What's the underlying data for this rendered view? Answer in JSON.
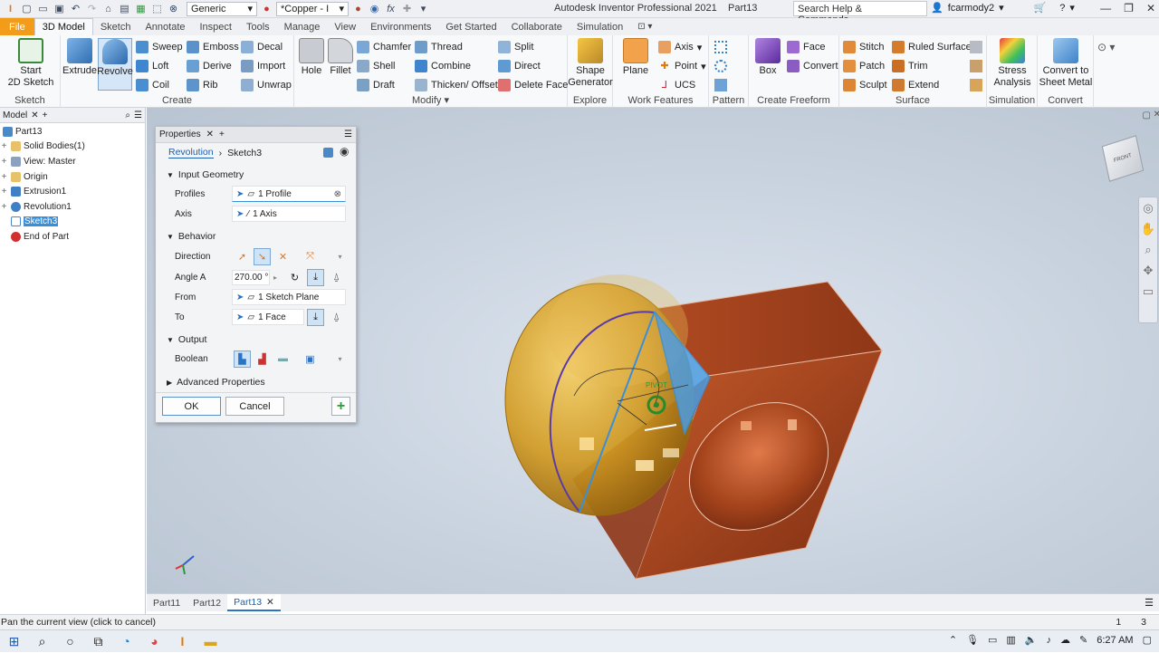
{
  "app": {
    "title": "Autodesk Inventor Professional 2021",
    "document": "Part13",
    "appearance_dropdown": "Generic",
    "material_dropdown": "*Copper - I",
    "search_placeholder": "Search Help & Commands...",
    "user": "fcarmody2",
    "fx_label": "fx"
  },
  "ribbon_tabs": [
    "File",
    "3D Model",
    "Sketch",
    "Annotate",
    "Inspect",
    "Tools",
    "Manage",
    "View",
    "Environments",
    "Get Started",
    "Collaborate",
    "Simulation"
  ],
  "ribbon": {
    "sketch": {
      "label": "Sketch",
      "start_sketch": "Start\n2D Sketch"
    },
    "create": {
      "label": "Create",
      "extrude": "Extrude",
      "revolve": "Revolve",
      "sweep": "Sweep",
      "emboss": "Emboss",
      "decal": "Decal",
      "loft": "Loft",
      "derive": "Derive",
      "import": "Import",
      "coil": "Coil",
      "rib": "Rib",
      "unwrap": "Unwrap"
    },
    "modify": {
      "label": "Modify",
      "hole": "Hole",
      "fillet": "Fillet",
      "chamfer": "Chamfer",
      "thread": "Thread",
      "split": "Split",
      "shell": "Shell",
      "combine": "Combine",
      "direct": "Direct",
      "draft": "Draft",
      "thicken": "Thicken/ Offset",
      "delete_face": "Delete Face"
    },
    "explore": {
      "label": "Explore",
      "shape_generator": "Shape\nGenerator"
    },
    "work_features": {
      "label": "Work Features",
      "plane": "Plane",
      "axis": "Axis",
      "point": "Point",
      "ucs": "UCS"
    },
    "pattern": {
      "label": "Pattern"
    },
    "freeform": {
      "label": "Create Freeform",
      "box": "Box",
      "face": "Face",
      "convert": "Convert"
    },
    "surface": {
      "label": "Surface",
      "stitch": "Stitch",
      "ruled_surface": "Ruled Surface",
      "patch": "Patch",
      "trim": "Trim",
      "sculpt": "Sculpt",
      "extend": "Extend"
    },
    "simulation": {
      "label": "Simulation",
      "stress": "Stress\nAnalysis"
    },
    "convert": {
      "label": "Convert",
      "sheet_metal": "Convert to\nSheet Metal"
    }
  },
  "browser": {
    "tab": "Model",
    "items": [
      {
        "label": "Part13",
        "expand": ""
      },
      {
        "label": "Solid Bodies(1)",
        "expand": "+"
      },
      {
        "label": "View: Master",
        "expand": "+"
      },
      {
        "label": "Origin",
        "expand": "+"
      },
      {
        "label": "Extrusion1",
        "expand": "+"
      },
      {
        "label": "Revolution1",
        "expand": "+"
      },
      {
        "label": "Sketch3",
        "expand": ""
      },
      {
        "label": "End of Part",
        "expand": ""
      }
    ]
  },
  "properties": {
    "tab": "Properties",
    "crumb_feature": "Revolution",
    "crumb_sketch": "Sketch3",
    "input_geometry": "Input Geometry",
    "profiles_label": "Profiles",
    "profiles_value": "1 Profile",
    "axis_label": "Axis",
    "axis_value": "1 Axis",
    "behavior": "Behavior",
    "direction_label": "Direction",
    "angle_label": "Angle A",
    "angle_value": "270.00 °",
    "from_label": "From",
    "from_value": "1 Sketch Plane",
    "to_label": "To",
    "to_value": "1 Face",
    "output": "Output",
    "boolean_label": "Boolean",
    "advanced": "Advanced Properties",
    "ok": "OK",
    "cancel": "Cancel"
  },
  "viewport": {
    "pivot_label": "PIVOT",
    "viewcube_label": "FRONT"
  },
  "doc_tabs": [
    "Part11",
    "Part12",
    "Part13"
  ],
  "status": {
    "text": "Pan the current view (click to cancel)",
    "num1": "1",
    "num2": "3"
  },
  "taskbar": {
    "time": "6:27 AM"
  },
  "colors": {
    "file_tab": "#f39c1a",
    "copper": "#9b3e1c",
    "gold": "#d59a1e",
    "selection": "#3a8fd8"
  }
}
